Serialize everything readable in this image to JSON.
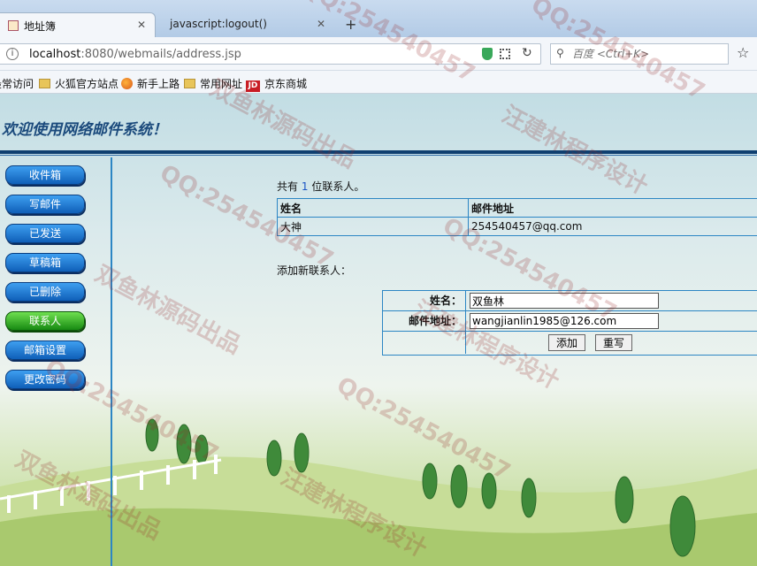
{
  "browser": {
    "tabs": [
      {
        "label": "地址簿",
        "active": true
      },
      {
        "label": "javascript:logout()",
        "active": false
      }
    ],
    "url_host": "localhost",
    "url_rest": ":8080/webmails/address.jsp",
    "search_placeholder": "百度 <Ctrl+K>",
    "bookmarks": [
      "最常访问",
      "火狐官方站点",
      "新手上路",
      "常用网址",
      "京东商城"
    ]
  },
  "page": {
    "welcome": "欢迎使用网络邮件系统！",
    "menu": [
      "收件箱",
      "写邮件",
      "已发送",
      "草稿箱",
      "已删除",
      "联系人",
      "邮箱设置",
      "更改密码"
    ],
    "active_menu": "联系人",
    "summary": {
      "prefix": "共有",
      "count": "1",
      "suffix": "位联系人。"
    },
    "table": {
      "headers": [
        "姓名",
        "邮件地址"
      ],
      "rows": [
        [
          "大神",
          "254540457@qq.com"
        ]
      ]
    },
    "add_title": "添加新联系人：",
    "form": {
      "name_label": "姓名：",
      "name_value": "双鱼林",
      "email_label": "邮件地址：",
      "email_value": "wangjianlin1985@126.com",
      "add_button": "添加",
      "reset_button": "重写"
    }
  },
  "watermarks": [
    "QQ:254540457",
    "汪建林程序设计",
    "双鱼林源码出品"
  ],
  "colors": {
    "accent": "#2c86c4",
    "menu_blue": "#1e74d0",
    "menu_active": "#2fa51f",
    "header_text": "#1b4a7c"
  }
}
